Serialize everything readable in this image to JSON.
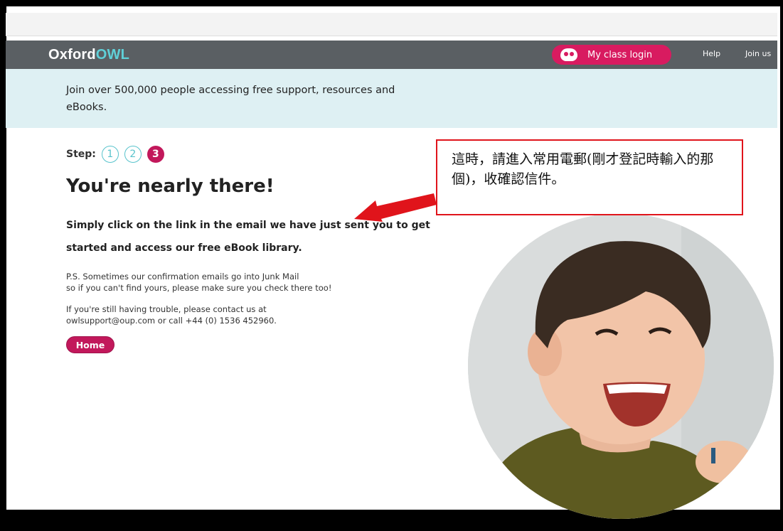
{
  "nav": {
    "logo_prefix": "Oxford",
    "logo_suffix": "OWL",
    "class_login": "My class login",
    "help": "Help",
    "join": "Join us"
  },
  "banner": {
    "text": "Join over 500,000 people accessing free support, resources and eBooks."
  },
  "steps": {
    "label": "Step:",
    "items": [
      "1",
      "2",
      "3"
    ],
    "current": "3"
  },
  "main": {
    "heading": "You're nearly there!",
    "lead": "Simply click on the link in the email we have just sent you to get started and access our free eBook library.",
    "ps_line1": "P.S. Sometimes our confirmation emails go into Junk Mail",
    "ps_line2": "so if you can't find yours, please make sure you check there too!",
    "trouble_line1": "If you're still having trouble, please contact us at",
    "trouble_line2": "owlsupport@oup.com or call +44 (0) 1536 452960.",
    "home_button": "Home"
  },
  "annotation": {
    "text": "這時，請進入常用電郵(剛才登記時輸入的那個)，收確認信件。"
  },
  "colors": {
    "nav_bg": "#5a5f63",
    "brand_pink": "#c2185b",
    "teal": "#58c3cc",
    "banner_bg": "#def0f3",
    "annotation_red": "#e0141b"
  }
}
